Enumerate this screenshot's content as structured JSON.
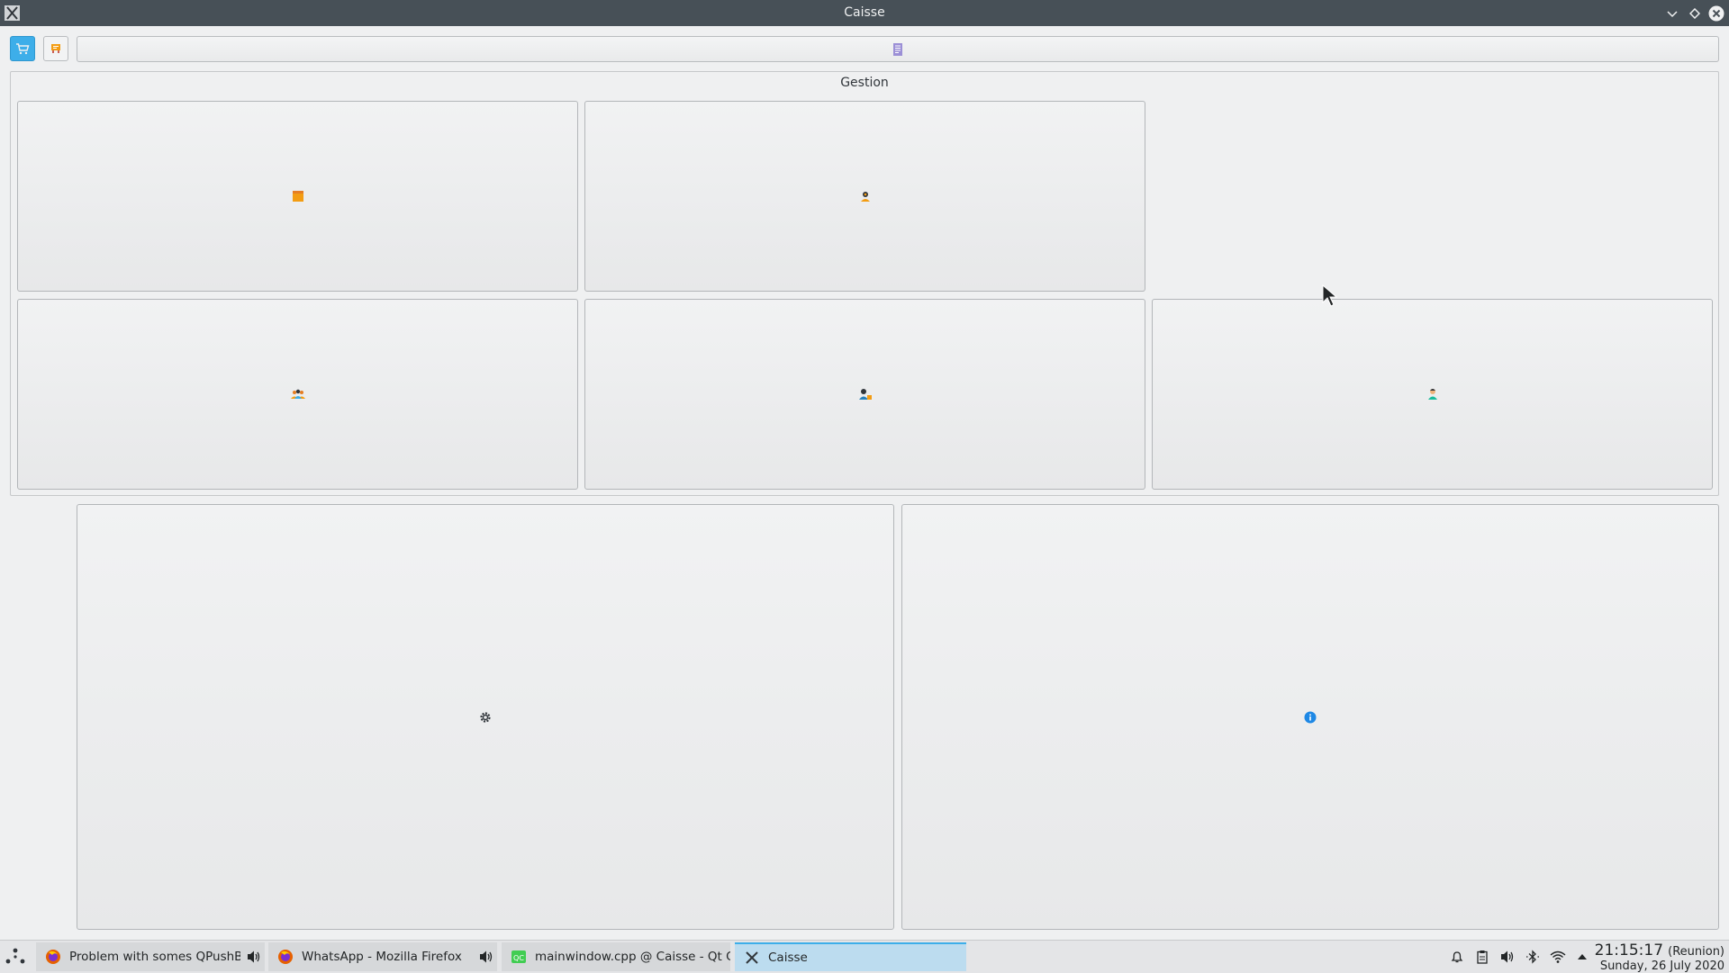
{
  "window": {
    "title": "Caisse"
  },
  "toolbar": {
    "cart_icon": "cart-icon",
    "order_icon": "order-icon",
    "document_icon": "document-icon"
  },
  "gestion": {
    "title": "Gestion",
    "buttons": [
      {
        "icon": "box-icon"
      },
      {
        "icon": "supplier-icon"
      },
      {
        "icon": "users-group-icon"
      },
      {
        "icon": "employee-icon"
      },
      {
        "icon": "client-icon"
      }
    ]
  },
  "bottom_buttons": [
    {
      "icon": "settings-gear-icon"
    },
    {
      "icon": "info-icon"
    }
  ],
  "taskbar": {
    "tasks": [
      {
        "label": "Problem with somes QPushBu...",
        "icon": "firefox-icon",
        "audio": true
      },
      {
        "label": "WhatsApp - Mozilla Firefox",
        "icon": "firefox-icon",
        "audio": true
      },
      {
        "label": "mainwindow.cpp @ Caisse - Qt Cre...",
        "icon": "qtcreator-icon",
        "audio": false
      },
      {
        "label": "Caisse",
        "icon": "x-app-icon",
        "audio": false
      }
    ],
    "clock": {
      "time": "21:15:17",
      "timezone": "(Reunion)",
      "date": "Sunday, 26 July 2020"
    },
    "colors": {
      "accent": "#3daee9",
      "active_task_bg": "#bcdcef"
    }
  }
}
